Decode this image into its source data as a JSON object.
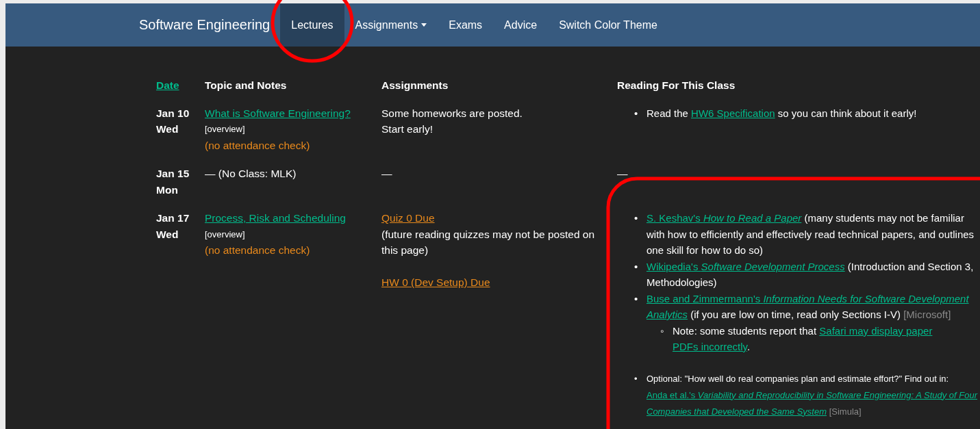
{
  "navbar": {
    "brand": "Software Engineering",
    "items": [
      {
        "label": "Lectures",
        "selected": true,
        "dropdown": false
      },
      {
        "label": "Assignments",
        "selected": false,
        "dropdown": true
      },
      {
        "label": "Exams",
        "selected": false,
        "dropdown": false
      },
      {
        "label": "Advice",
        "selected": false,
        "dropdown": false
      },
      {
        "label": "Switch Color Theme",
        "selected": false,
        "dropdown": false
      }
    ]
  },
  "table": {
    "columns": [
      {
        "label": "Date",
        "kind": "link"
      },
      {
        "label": "Topic and Notes",
        "kind": "text"
      },
      {
        "label": "Assignments",
        "kind": "text"
      },
      {
        "label": "Reading For This Class",
        "kind": "text"
      }
    ],
    "rows": [
      {
        "date": "Jan 10",
        "day": "Wed",
        "topic": [
          {
            "kind": "link",
            "text": "What is Software Engineering?"
          },
          {
            "kind": "tag",
            "text": "[overview]"
          },
          {
            "kind": "note",
            "text": "(no attendance check)"
          }
        ],
        "assignments": [
          {
            "kind": "text",
            "text": "Some homeworks are posted."
          },
          {
            "kind": "text",
            "text": "Start early!"
          }
        ],
        "reading": [
          {
            "kind": "item",
            "marker": "•",
            "segments": [
              {
                "kind": "text",
                "text": "Read the"
              },
              {
                "kind": "link",
                "text": "HW6 Specification"
              },
              {
                "kind": "text",
                "text": "so you can think about it early!"
              }
            ]
          }
        ]
      },
      {
        "date": "Jan 15",
        "day": "Mon",
        "topic": [
          {
            "kind": "text",
            "text": "— (No Class: MLK)"
          }
        ],
        "assignments": [
          {
            "kind": "text",
            "text": "—"
          }
        ],
        "reading": [
          {
            "kind": "plain",
            "segments": [
              {
                "kind": "text",
                "text": "—"
              }
            ]
          }
        ]
      },
      {
        "date": "Jan 17",
        "day": "Wed",
        "topic": [
          {
            "kind": "link",
            "text": "Process, Risk and Scheduling"
          },
          {
            "kind": "tag",
            "text": "[overview]"
          },
          {
            "kind": "note",
            "text": "(no attendance check)"
          }
        ],
        "assignments": [
          {
            "kind": "link",
            "text": "Quiz 0 Due"
          },
          {
            "kind": "text",
            "text": "(future reading quizzes may not be posted on this page)"
          },
          {
            "kind": "spaced-link",
            "text": "HW 0 (Dev Setup) Due"
          }
        ],
        "reading": [
          {
            "kind": "item",
            "marker": "•",
            "segments": [
              {
                "kind": "link",
                "text": "S. Keshav's *How to Read a Paper*"
              },
              {
                "kind": "text",
                "text": "(many students may not be familiar with how to efficiently and effectively read technical papers, and outlines one skill for how to do so)"
              }
            ]
          },
          {
            "kind": "item",
            "marker": "•",
            "segments": [
              {
                "kind": "link",
                "text": "Wikipedia's *Software Development Process*"
              },
              {
                "kind": "text",
                "text": "(Introduction and Section 3, Methodologies)"
              }
            ]
          },
          {
            "kind": "item",
            "marker": "•",
            "segments": [
              {
                "kind": "link",
                "text": "Buse and Zimmermann's *Information Needs for Software Development*"
              },
              {
                "kind": "link",
                "text": "*Analytics*"
              },
              {
                "kind": "text",
                "text": "(if you are low on time, read only Sections I-V)"
              },
              {
                "kind": "source",
                "text": "[Microsoft]"
              }
            ],
            "children": [
              {
                "kind": "item",
                "marker": "◦",
                "segments": [
                  {
                    "kind": "text",
                    "text": "Note: some students report that"
                  },
                  {
                    "kind": "link",
                    "text": "Safari may display paper"
                  },
                  {
                    "kind": "link-end",
                    "text": "PDFs incorrectly"
                  },
                  {
                    "kind": "tail",
                    "text": "."
                  }
                ]
              }
            ]
          },
          {
            "kind": "small-item",
            "marker": "•",
            "segments": [
              {
                "kind": "text",
                "text": "Optional: \"How well do real companies plan and estimate effort?\" Find out in:"
              },
              {
                "kind": "link",
                "text": "Anda et al.'s *Variability and Reproducibility in Software Engineering: A Study of Four*"
              },
              {
                "kind": "link",
                "text": "*Companies that Developed the Same System*"
              },
              {
                "kind": "source",
                "text": "[Simula]"
              }
            ]
          }
        ]
      }
    ]
  },
  "annotations": [
    {
      "kind": "circle"
    },
    {
      "kind": "rounded-rect"
    }
  ]
}
